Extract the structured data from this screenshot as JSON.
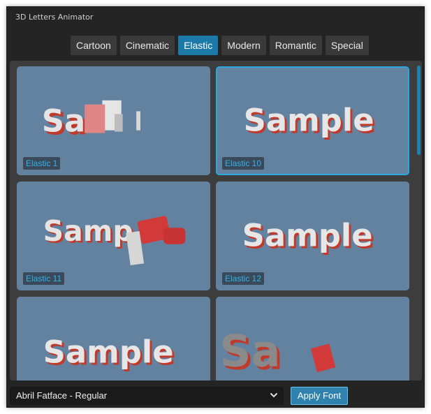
{
  "window": {
    "title": "3D Letters Animator"
  },
  "tabs": [
    {
      "label": "Cartoon"
    },
    {
      "label": "Cinematic"
    },
    {
      "label": "Elastic",
      "active": true
    },
    {
      "label": "Modern"
    },
    {
      "label": "Romantic"
    },
    {
      "label": "Special"
    }
  ],
  "cards": [
    {
      "label": "Elastic 1",
      "preview_text": "Sa"
    },
    {
      "label": "Elastic 10",
      "preview_text": "Sample",
      "selected": true
    },
    {
      "label": "Elastic 11",
      "preview_text": "Samp"
    },
    {
      "label": "Elastic 12",
      "preview_text": "Sample"
    },
    {
      "label": "",
      "preview_text": "Sample"
    },
    {
      "label": "",
      "preview_text": "Sa"
    }
  ],
  "footer": {
    "font_value": "Abril Fatface - Regular",
    "apply_label": "Apply Font"
  },
  "colors": {
    "accent": "#1c7aa8",
    "card_bg": "#6282a0",
    "badge_text": "#31b3ea",
    "letter_face": "#e2e2e2",
    "letter_side": "#d23a3a"
  }
}
